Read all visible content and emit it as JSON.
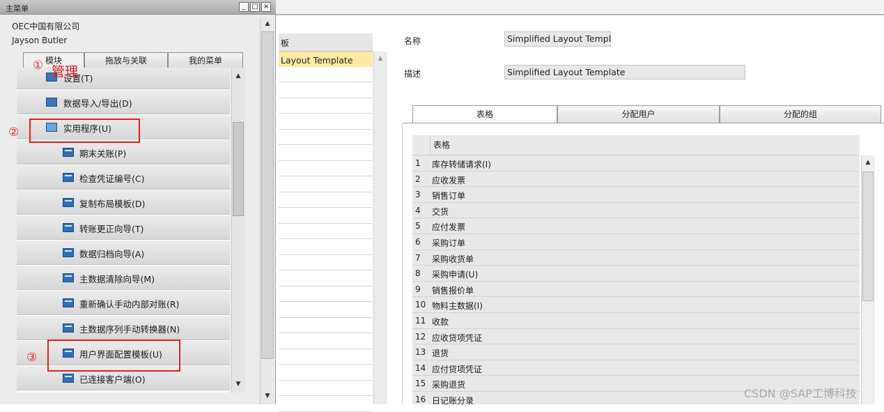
{
  "main_menu": {
    "title": "主菜单",
    "window_buttons": {
      "minimize": "_",
      "restore": "□",
      "close": "×"
    },
    "company": "OEC中国有限公司",
    "user": "Jayson Butler",
    "tabs": [
      "模块",
      "拖放与关联",
      "我的菜单"
    ],
    "items": [
      {
        "label": "设置(T)",
        "icon": "folder-icon",
        "indent": 0
      },
      {
        "label": "数据导入/导出(D)",
        "icon": "folder-icon",
        "indent": 0
      },
      {
        "label": "实用程序(U)",
        "icon": "folder-open-icon",
        "indent": 0
      },
      {
        "label": "期末关账(P)",
        "icon": "document-icon",
        "indent": 1
      },
      {
        "label": "检查凭证编号(C)",
        "icon": "document-icon",
        "indent": 1
      },
      {
        "label": "复制布局模板(D)",
        "icon": "document-icon",
        "indent": 1
      },
      {
        "label": "转账更正向导(T)",
        "icon": "document-icon",
        "indent": 1
      },
      {
        "label": "数据归档向导(A)",
        "icon": "document-icon",
        "indent": 1
      },
      {
        "label": "主数据清除向导(M)",
        "icon": "document-icon",
        "indent": 1
      },
      {
        "label": "重新确认手动内部对账(R)",
        "icon": "document-icon",
        "indent": 1
      },
      {
        "label": "主数据序列手动转换器(N)",
        "icon": "document-icon",
        "indent": 1
      },
      {
        "label": "用户界面配置模板(U)",
        "icon": "document-icon",
        "indent": 1
      },
      {
        "label": "已连接客户端(O)",
        "icon": "document-icon",
        "indent": 1
      }
    ]
  },
  "annotations": {
    "step1": "①",
    "step1_text": "管理",
    "step2": "②",
    "step3": "③"
  },
  "template_list": {
    "header": "板",
    "selected": "Layout Template"
  },
  "detail": {
    "name_label": "名称",
    "name_value": "Simplified Layout Templa",
    "desc_label": "描述",
    "desc_value": "Simplified Layout Template",
    "tabs": [
      "表格",
      "分配用户",
      "分配的组"
    ],
    "grid_header": "表格",
    "forms": [
      {
        "n": "1",
        "name": "库存转储请求(I)"
      },
      {
        "n": "2",
        "name": "应收发票"
      },
      {
        "n": "3",
        "name": "销售订单"
      },
      {
        "n": "4",
        "name": "交货"
      },
      {
        "n": "5",
        "name": "应付发票"
      },
      {
        "n": "6",
        "name": "采购订单"
      },
      {
        "n": "7",
        "name": "采购收货单"
      },
      {
        "n": "8",
        "name": "采购申请(U)"
      },
      {
        "n": "9",
        "name": "销售报价单"
      },
      {
        "n": "10",
        "name": "物料主数据(I)"
      },
      {
        "n": "11",
        "name": "收款"
      },
      {
        "n": "12",
        "name": "应收贷项凭证"
      },
      {
        "n": "13",
        "name": "退货"
      },
      {
        "n": "14",
        "name": "应付贷项凭证"
      },
      {
        "n": "15",
        "name": "采购退货"
      },
      {
        "n": "16",
        "name": "日记账分录"
      }
    ]
  },
  "watermark": "CSDN @SAP工博科技"
}
